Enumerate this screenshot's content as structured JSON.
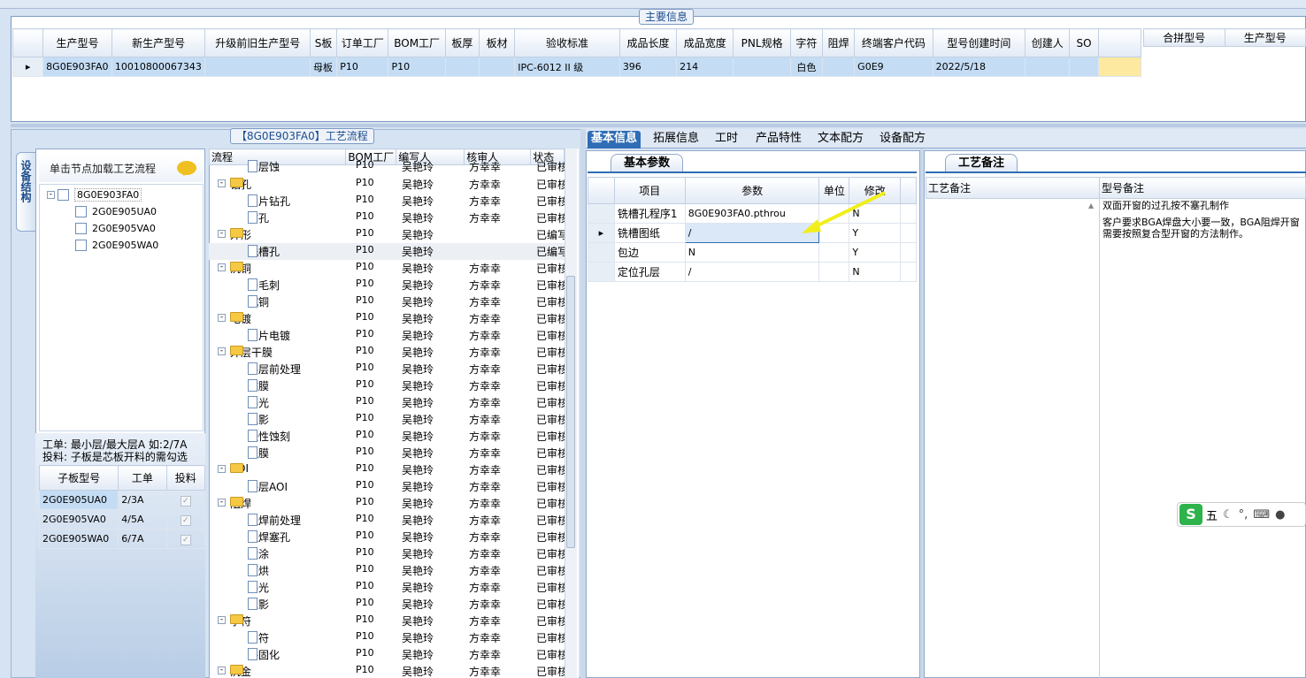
{
  "main_info": {
    "title": "主要信息",
    "columns": [
      "生产型号",
      "新生产型号",
      "升级前旧生产型号",
      "S板",
      "订单工厂",
      "BOM工厂",
      "板厚",
      "板材",
      "验收标准",
      "成品长度",
      "成品宽度",
      "PNL规格",
      "字符",
      "阻焊",
      "终端客户代码",
      "型号创建时间",
      "创建人",
      "SO"
    ],
    "row": {
      "marker": "▸",
      "values": [
        "8G0E903FA0",
        "10010800067343",
        "",
        "母板",
        "P10",
        "P10",
        "",
        "",
        "IPC-6012 II 级",
        "396",
        "214",
        "",
        "白色",
        "",
        "G0E9",
        "2022/5/18",
        "",
        ""
      ]
    },
    "side_columns": [
      "合拼型号",
      "生产型号"
    ]
  },
  "process_flow_label": "【8G0E903FA0】工艺流程",
  "left_panel": {
    "vertical_tab": "设备结构",
    "click_hint": "单击节点加载工艺流程",
    "tree": {
      "root": "8G0E903FA0",
      "children": [
        "2G0E905UA0",
        "2G0E905VA0",
        "2G0E905WA0"
      ]
    },
    "note_line1": "工单: 最小层/最大层A 如:2/7A",
    "note_line2": "投料: 子板是芯板开料的需勾选",
    "sub_table": {
      "columns": [
        "子板型号",
        "工单",
        "投料"
      ],
      "rows": [
        {
          "model": "2G0E905UA0",
          "order": "2/3A",
          "check": "✓"
        },
        {
          "model": "2G0E905VA0",
          "order": "4/5A",
          "check": "✓"
        },
        {
          "model": "2G0E905WA0",
          "order": "6/7A",
          "check": "✓"
        }
      ]
    }
  },
  "process_grid": {
    "columns": [
      "流程",
      "BOM工厂",
      "编写人",
      "核审人",
      "状态"
    ],
    "rows": [
      {
        "type": "doc",
        "name": "内层蚀",
        "bom": "P10",
        "writer": "吴艳玲",
        "reviewer": "方幸幸",
        "status": "已审核"
      },
      {
        "type": "folder",
        "name": "钻孔",
        "bom": "P10",
        "writer": "吴艳玲",
        "reviewer": "方幸幸",
        "status": "已审核"
      },
      {
        "type": "doc",
        "name": "铝片钻孔",
        "bom": "P10",
        "writer": "吴艳玲",
        "reviewer": "方幸幸",
        "status": "已审核"
      },
      {
        "type": "doc",
        "name": "钻孔",
        "bom": "P10",
        "writer": "吴艳玲",
        "reviewer": "方幸幸",
        "status": "已审核"
      },
      {
        "type": "folder",
        "name": "外形",
        "bom": "P10",
        "writer": "吴艳玲",
        "reviewer": "",
        "status": "已编写"
      },
      {
        "type": "doc",
        "name": "铣槽孔",
        "bom": "P10",
        "writer": "吴艳玲",
        "reviewer": "",
        "status": "已编写"
      },
      {
        "type": "folder",
        "name": "沉铜",
        "bom": "P10",
        "writer": "吴艳玲",
        "reviewer": "方幸幸",
        "status": "已审核"
      },
      {
        "type": "doc",
        "name": "去毛刺",
        "bom": "P10",
        "writer": "吴艳玲",
        "reviewer": "方幸幸",
        "status": "已审核"
      },
      {
        "type": "doc",
        "name": "沉铜",
        "bom": "P10",
        "writer": "吴艳玲",
        "reviewer": "方幸幸",
        "status": "已审核"
      },
      {
        "type": "folder",
        "name": "电镀",
        "bom": "P10",
        "writer": "吴艳玲",
        "reviewer": "方幸幸",
        "status": "已审核"
      },
      {
        "type": "doc",
        "name": "负片电镀",
        "bom": "P10",
        "writer": "吴艳玲",
        "reviewer": "方幸幸",
        "status": "已审核"
      },
      {
        "type": "folder",
        "name": "外层干膜",
        "bom": "P10",
        "writer": "吴艳玲",
        "reviewer": "方幸幸",
        "status": "已审核"
      },
      {
        "type": "doc",
        "name": "外层前处理",
        "bom": "P10",
        "writer": "吴艳玲",
        "reviewer": "方幸幸",
        "status": "已审核"
      },
      {
        "type": "doc",
        "name": "贴膜",
        "bom": "P10",
        "writer": "吴艳玲",
        "reviewer": "方幸幸",
        "status": "已审核"
      },
      {
        "type": "doc",
        "name": "曝光",
        "bom": "P10",
        "writer": "吴艳玲",
        "reviewer": "方幸幸",
        "status": "已审核"
      },
      {
        "type": "doc",
        "name": "显影",
        "bom": "P10",
        "writer": "吴艳玲",
        "reviewer": "方幸幸",
        "status": "已审核"
      },
      {
        "type": "doc",
        "name": "酸性蚀刻",
        "bom": "P10",
        "writer": "吴艳玲",
        "reviewer": "方幸幸",
        "status": "已审核"
      },
      {
        "type": "doc",
        "name": "退膜",
        "bom": "P10",
        "writer": "吴艳玲",
        "reviewer": "方幸幸",
        "status": "已审核"
      },
      {
        "type": "folder",
        "name": "AOI",
        "bom": "P10",
        "writer": "吴艳玲",
        "reviewer": "方幸幸",
        "status": "已审核"
      },
      {
        "type": "doc",
        "name": "外层AOI",
        "bom": "P10",
        "writer": "吴艳玲",
        "reviewer": "方幸幸",
        "status": "已审核"
      },
      {
        "type": "folder",
        "name": "阻焊",
        "bom": "P10",
        "writer": "吴艳玲",
        "reviewer": "方幸幸",
        "status": "已审核"
      },
      {
        "type": "doc",
        "name": "阻焊前处理",
        "bom": "P10",
        "writer": "吴艳玲",
        "reviewer": "方幸幸",
        "status": "已审核"
      },
      {
        "type": "doc",
        "name": "阻焊塞孔",
        "bom": "P10",
        "writer": "吴艳玲",
        "reviewer": "方幸幸",
        "status": "已审核"
      },
      {
        "type": "doc",
        "name": "喷涂",
        "bom": "P10",
        "writer": "吴艳玲",
        "reviewer": "方幸幸",
        "status": "已审核"
      },
      {
        "type": "doc",
        "name": "预烘",
        "bom": "P10",
        "writer": "吴艳玲",
        "reviewer": "方幸幸",
        "status": "已审核"
      },
      {
        "type": "doc",
        "name": "曝光",
        "bom": "P10",
        "writer": "吴艳玲",
        "reviewer": "方幸幸",
        "status": "已审核"
      },
      {
        "type": "doc",
        "name": "显影",
        "bom": "P10",
        "writer": "吴艳玲",
        "reviewer": "方幸幸",
        "status": "已审核"
      },
      {
        "type": "folder",
        "name": "字符",
        "bom": "P10",
        "writer": "吴艳玲",
        "reviewer": "方幸幸",
        "status": "已审核"
      },
      {
        "type": "doc",
        "name": "字符",
        "bom": "P10",
        "writer": "吴艳玲",
        "reviewer": "方幸幸",
        "status": "已审核"
      },
      {
        "type": "doc",
        "name": "终固化",
        "bom": "P10",
        "writer": "吴艳玲",
        "reviewer": "方幸幸",
        "status": "已审核"
      },
      {
        "type": "folder",
        "name": "沉金",
        "bom": "P10",
        "writer": "吴艳玲",
        "reviewer": "方幸幸",
        "status": "已审核"
      }
    ]
  },
  "tabs": [
    "基本信息",
    "拓展信息",
    "工时",
    "产品特性",
    "文本配方",
    "设备配方"
  ],
  "basic_params": {
    "section_title": "基本参数",
    "columns": [
      "项目",
      "参数",
      "单位",
      "修改"
    ],
    "rows": [
      {
        "item": "铣槽孔程序1",
        "param": "8G0E903FA0.pthrou",
        "unit": "",
        "mod": "N"
      },
      {
        "item": "铣槽图纸",
        "param": "/",
        "unit": "",
        "mod": "Y"
      },
      {
        "item": "包边",
        "param": "N",
        "unit": "",
        "mod": "Y"
      },
      {
        "item": "定位孔层",
        "param": "/",
        "unit": "",
        "mod": "N"
      }
    ]
  },
  "process_notes": {
    "section_title": "工艺备注",
    "col_left": "工艺备注",
    "col_right": "型号备注",
    "model_note_line1": "双面开窗的过孔按不塞孔制作",
    "model_note_line2": "客户要求BGA焊盘大小要一致，BGA阻焊开窗需要按照复合型开窗的方法制作。"
  },
  "ime": {
    "logo": "S",
    "mode": "五"
  },
  "colors": {
    "accent": "#2f6db5",
    "selected_row": "#c4ddf5",
    "highlight": "#fde9a0",
    "arrow": "#f2ee1a"
  }
}
